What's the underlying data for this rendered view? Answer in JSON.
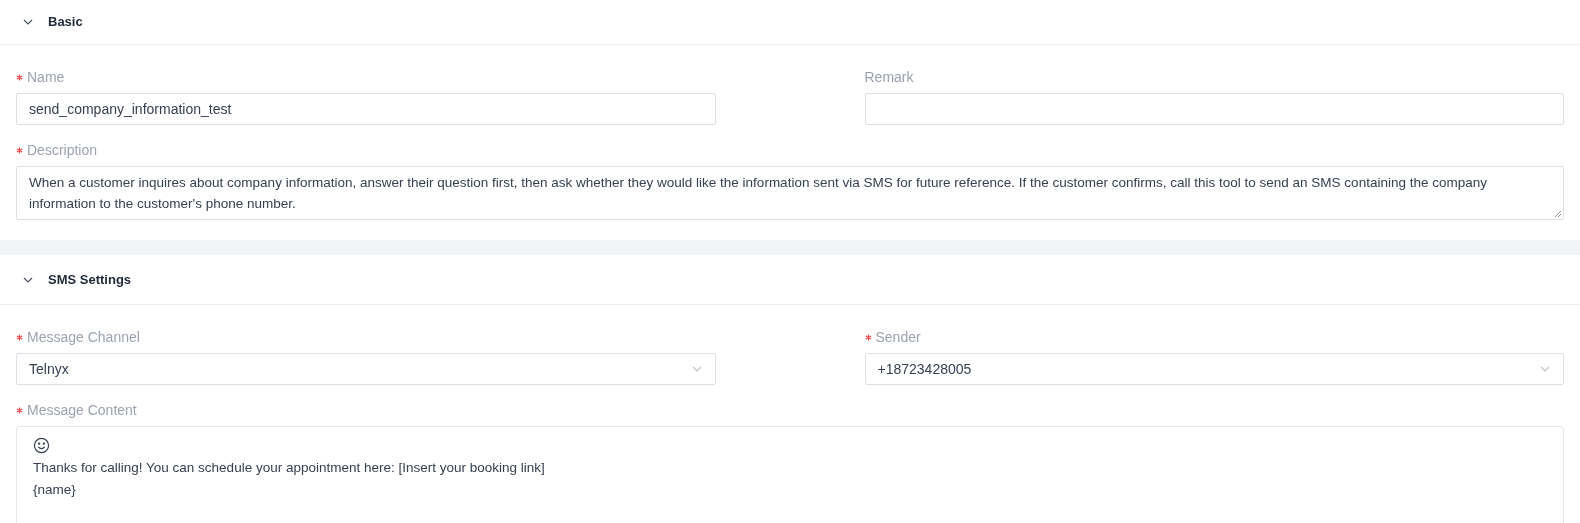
{
  "sections": [
    {
      "title": "Basic",
      "expanded": true,
      "rows": [
        [
          {
            "label": "Name",
            "required": true,
            "kind": "input",
            "value": "send_company_information_test"
          },
          {
            "label": "Remark",
            "required": false,
            "kind": "input"
          }
        ],
        [
          {
            "label": "Description",
            "required": true,
            "kind": "textarea",
            "value": "When a customer inquires about company information, answer their question first, then ask whether they would like the information sent via SMS for future reference. If the customer confirms, call this tool to send an SMS containing the company information to the customer's phone number."
          }
        ]
      ]
    },
    {
      "title": "SMS Settings",
      "expanded": true,
      "rows": [
        [
          {
            "label": "Message Channel",
            "required": true,
            "kind": "select",
            "value": "Telnyx"
          },
          {
            "label": "Sender",
            "required": true,
            "kind": "select",
            "value": "+18723428005"
          }
        ],
        [
          {
            "label": "Message Content",
            "required": true,
            "kind": "editor",
            "lines": [
              "Thanks for calling! You can schedule your appointment here: [Insert your booking link]",
              "{name}"
            ]
          }
        ]
      ]
    }
  ]
}
